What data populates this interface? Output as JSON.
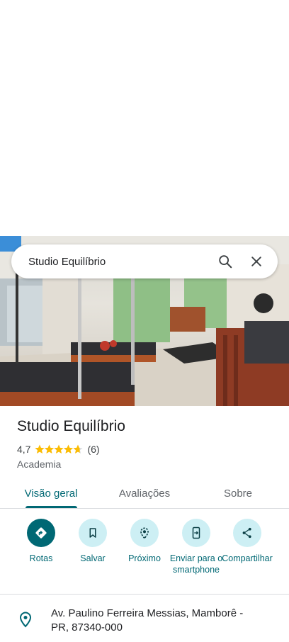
{
  "search": {
    "query": "Studio Equilíbrio"
  },
  "place": {
    "name": "Studio Equilíbrio",
    "rating": "4,7",
    "rating_value": 4.7,
    "review_count": "(6)",
    "category": "Academia"
  },
  "tabs": [
    {
      "label": "Visão geral",
      "active": true
    },
    {
      "label": "Avaliações",
      "active": false
    },
    {
      "label": "Sobre",
      "active": false
    }
  ],
  "actions": [
    {
      "label": "Rotas",
      "icon": "directions-icon"
    },
    {
      "label": "Salvar",
      "icon": "bookmark-icon"
    },
    {
      "label": "Próximo",
      "icon": "nearby-icon"
    },
    {
      "label": "Enviar para o smartphone",
      "icon": "send-to-phone-icon"
    },
    {
      "label": "Compartilhar",
      "icon": "share-icon"
    }
  ],
  "address": {
    "text": "Av. Paulino Ferreira Messias, Mamborê - PR, 87340-000",
    "icon": "location-pin-icon"
  },
  "colors": {
    "accent": "#006874",
    "accent_light": "#cdeff4",
    "star": "#fbbc04"
  }
}
